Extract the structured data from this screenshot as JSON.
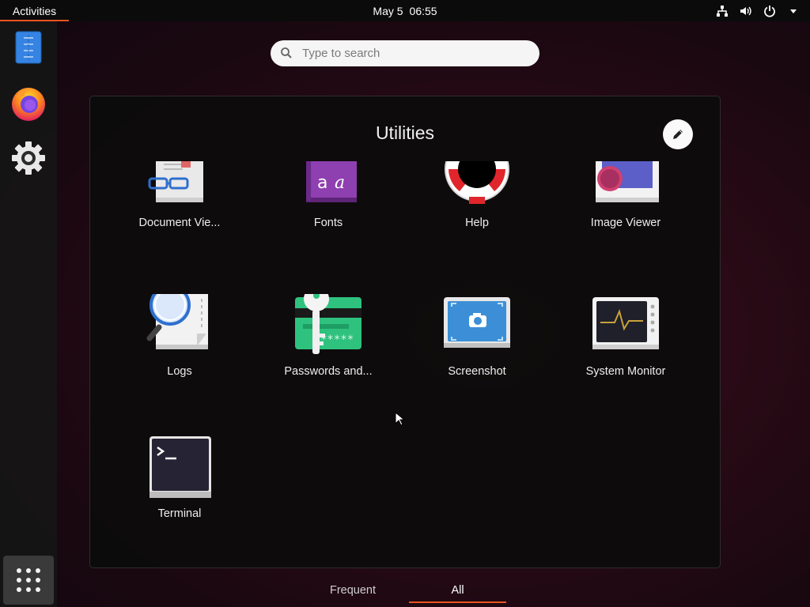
{
  "topbar": {
    "activities_label": "Activities",
    "date": "May 5",
    "time": "06:55",
    "tray_icons": [
      "network-icon",
      "volume-icon",
      "power-icon",
      "dropdown-arrow-icon"
    ]
  },
  "dock": {
    "items": [
      {
        "name": "Text Editor",
        "icon": "text-editor-icon"
      },
      {
        "name": "Firefox",
        "icon": "firefox-icon"
      },
      {
        "name": "Settings",
        "icon": "settings-gear-icon"
      }
    ],
    "show_apps_icon": "apps-grid-icon"
  },
  "search": {
    "placeholder": "Type to search"
  },
  "folder": {
    "title": "Utilities",
    "edit_icon": "pencil-icon",
    "apps": [
      {
        "label": "Document Vie...",
        "icon": "document-viewer-icon"
      },
      {
        "label": "Fonts",
        "icon": "fonts-icon"
      },
      {
        "label": "Help",
        "icon": "help-lifebuoy-icon"
      },
      {
        "label": "Image Viewer",
        "icon": "image-viewer-icon"
      },
      {
        "label": "Logs",
        "icon": "logs-magnifier-icon"
      },
      {
        "label": "Passwords and...",
        "icon": "passwords-key-icon"
      },
      {
        "label": "Screenshot",
        "icon": "screenshot-camera-icon"
      },
      {
        "label": "System Monitor",
        "icon": "system-monitor-icon"
      },
      {
        "label": "Terminal",
        "icon": "terminal-icon"
      }
    ]
  },
  "tabs": {
    "frequent": "Frequent",
    "all": "All",
    "active": "All"
  },
  "colors": {
    "accent": "#e95420",
    "panel": "#0c0c0c",
    "topbar": "#0b0b0b"
  }
}
